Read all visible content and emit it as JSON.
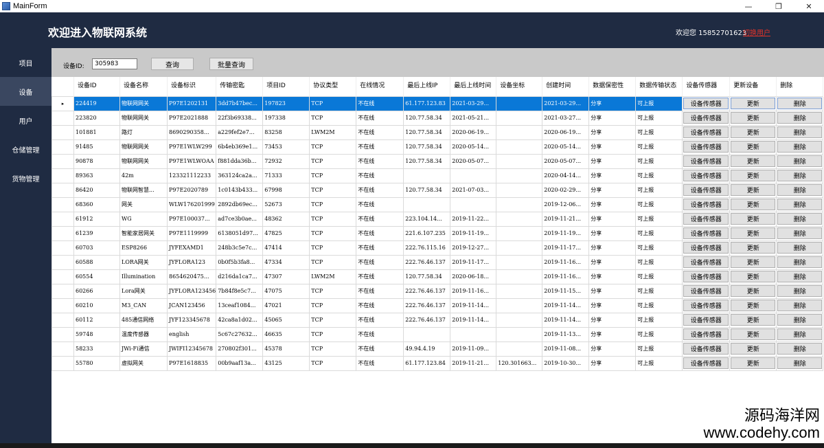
{
  "window": {
    "title": "MainForm"
  },
  "header": {
    "title": "欢迎进入物联网系统",
    "welcome": "欢迎您 15852701623",
    "switch_user": "切换用户"
  },
  "sidebar": {
    "items": [
      {
        "label": "项目"
      },
      {
        "label": "设备"
      },
      {
        "label": "用户"
      },
      {
        "label": "仓储管理"
      },
      {
        "label": "货物管理"
      }
    ],
    "active": "设备"
  },
  "toolbar": {
    "device_id_label": "设备ID:",
    "device_id_value": "305983",
    "query_label": "查询",
    "batch_query_label": "批量查询"
  },
  "table": {
    "columns": [
      "设备ID",
      "设备名称",
      "设备标识",
      "传输密匙",
      "项目ID",
      "协议类型",
      "在线情况",
      "最后上线IP",
      "最后上线时间",
      "设备坐标",
      "创建时间",
      "数据保密性",
      "数据传输状态",
      "设备传感器",
      "更新设备",
      "删除"
    ],
    "selected_row_marker": "▸",
    "button_labels": {
      "sensor": "设备传感器",
      "update": "更新",
      "delete": "删除"
    },
    "rows": [
      [
        "224419",
        "物联网网关",
        "P97E1202131",
        "3dd7b47bec...",
        "197823",
        "TCP",
        "不在线",
        "61.177.123.83",
        "2021-03-29...",
        "",
        "2021-03-29...",
        "分享",
        "可上报"
      ],
      [
        "223820",
        "物联网网关",
        "P97E2021888",
        "22f3b69338...",
        "197338",
        "TCP",
        "不在线",
        "120.77.58.34",
        "2021-05-21...",
        "",
        "2021-03-27...",
        "分享",
        "可上报"
      ],
      [
        "101881",
        "路灯",
        "8690290358...",
        "a229fef2e7...",
        "83258",
        "LWM2M",
        "不在线",
        "120.77.58.34",
        "2020-06-19...",
        "",
        "2020-06-19...",
        "分享",
        "可上报"
      ],
      [
        "91485",
        "物联网网关",
        "P97E1WLW299",
        "6b4eb369e1...",
        "73453",
        "TCP",
        "不在线",
        "120.77.58.34",
        "2020-05-14...",
        "",
        "2020-05-14...",
        "分享",
        "可上报"
      ],
      [
        "90878",
        "物联网网关",
        "P97E1WLWOAA",
        "f881dda36b...",
        "72932",
        "TCP",
        "不在线",
        "120.77.58.34",
        "2020-05-07...",
        "",
        "2020-05-07...",
        "分享",
        "可上报"
      ],
      [
        "89363",
        "42m",
        "123321112233",
        "363124ca2a...",
        "71333",
        "TCP",
        "不在线",
        "",
        "",
        "",
        "2020-04-14...",
        "分享",
        "可上报"
      ],
      [
        "86420",
        "物联网智慧...",
        "P97E2020789",
        "1c0143b433...",
        "67998",
        "TCP",
        "不在线",
        "120.77.58.34",
        "2021-07-03...",
        "",
        "2020-02-29...",
        "分享",
        "可上报"
      ],
      [
        "68360",
        "网关",
        "WLW176201999",
        "2892db69ec...",
        "52673",
        "TCP",
        "不在线",
        "",
        "",
        "",
        "2019-12-06...",
        "分享",
        "可上报"
      ],
      [
        "61912",
        "WG",
        "P97E100037...",
        "ad7ce3b0ae...",
        "48362",
        "TCP",
        "不在线",
        "223.104.14...",
        "2019-11-22...",
        "",
        "2019-11-21...",
        "分享",
        "可上报"
      ],
      [
        "61239",
        "智能家居网关",
        "P97E1119999",
        "6138051d97...",
        "47825",
        "TCP",
        "不在线",
        "221.6.107.235",
        "2019-11-19...",
        "",
        "2019-11-19...",
        "分享",
        "可上报"
      ],
      [
        "60703",
        "ESP8266",
        "JYFEXAMD1",
        "248b3c5e7c...",
        "47414",
        "TCP",
        "不在线",
        "222.76.115.16",
        "2019-12-27...",
        "",
        "2019-11-17...",
        "分享",
        "可上报"
      ],
      [
        "60588",
        "LORA网关",
        "JYFLORA123",
        "0b0f5b3fa8...",
        "47334",
        "TCP",
        "不在线",
        "222.76.46.137",
        "2019-11-17...",
        "",
        "2019-11-16...",
        "分享",
        "可上报"
      ],
      [
        "60554",
        "Illumination",
        "8654620475...",
        "d216da1ca7...",
        "47307",
        "LWM2M",
        "不在线",
        "120.77.58.34",
        "2020-06-18...",
        "",
        "2019-11-16...",
        "分享",
        "可上报"
      ],
      [
        "60266",
        "Lora网关",
        "JYFLORA123456",
        "7b84f8e5c7...",
        "47075",
        "TCP",
        "不在线",
        "222.76.46.137",
        "2019-11-16...",
        "",
        "2019-11-15...",
        "分享",
        "可上报"
      ],
      [
        "60210",
        "M3_CAN",
        "JCAN123456",
        "13ceaf1084...",
        "47021",
        "TCP",
        "不在线",
        "222.76.46.137",
        "2019-11-14...",
        "",
        "2019-11-14...",
        "分享",
        "可上报"
      ],
      [
        "60112",
        "485通信网络",
        "JYF123345678",
        "42ca8a1d02...",
        "45065",
        "TCP",
        "不在线",
        "222.76.46.137",
        "2019-11-14...",
        "",
        "2019-11-14...",
        "分享",
        "可上报"
      ],
      [
        "59748",
        "温度传感器",
        "english",
        "5c67c27632...",
        "46635",
        "TCP",
        "不在线",
        "",
        "",
        "",
        "2019-11-13...",
        "分享",
        "可上报"
      ],
      [
        "58233",
        "JWi-Fi通信",
        "JWIFI12345678",
        "270802f301...",
        "45378",
        "TCP",
        "不在线",
        "49.94.4.19",
        "2019-11-09...",
        "",
        "2019-11-08...",
        "分享",
        "可上报"
      ],
      [
        "55780",
        "虚拟网关",
        "P97E1618835",
        "00b9aaf13a...",
        "43125",
        "TCP",
        "不在线",
        "61.177.123.84",
        "2019-11-21...",
        "120.301663...",
        "2019-10-30...",
        "分享",
        "可上报"
      ]
    ]
  },
  "watermark": {
    "line1": "源码海洋网",
    "line2": "www.codehy.com"
  },
  "colors": {
    "sidebar_bg": "#1f2b42",
    "selection": "#0a78d7",
    "link_red": "#e0332a"
  }
}
